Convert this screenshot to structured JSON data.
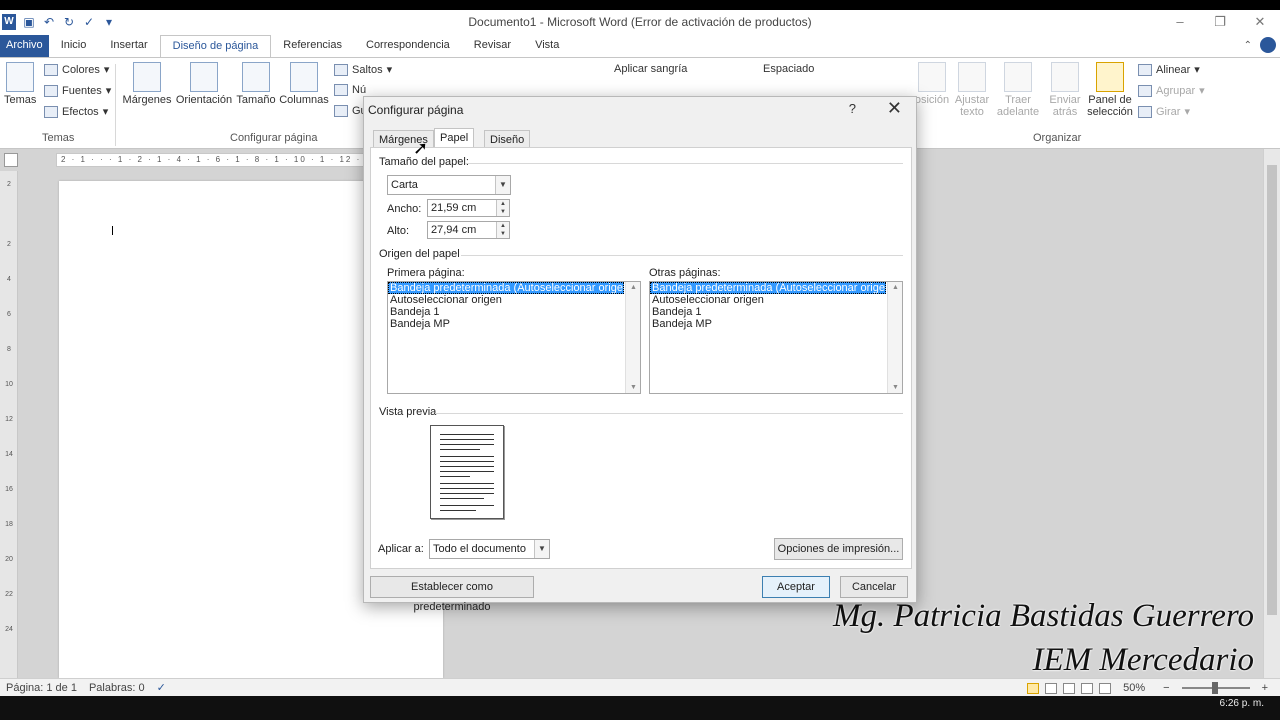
{
  "window": {
    "title": "Documento1 - Microsoft Word (Error de activación de productos)",
    "buttons": [
      "–",
      "❐",
      "✕"
    ]
  },
  "qat": {
    "logo": "W",
    "save_icon": "save-icon",
    "undo_icon": "undo-icon",
    "redo_icon": "redo-icon",
    "spell_icon": "spellcheck-icon"
  },
  "tabs": [
    "Archivo",
    "Inicio",
    "Insertar",
    "Diseño de página",
    "Referencias",
    "Correspondencia",
    "Revisar",
    "Vista"
  ],
  "active_tab": "Diseño de página",
  "ribbon": {
    "temas": {
      "label": "Temas",
      "group": "Temas"
    },
    "colores": "Colores",
    "fuentes": "Fuentes",
    "efectos": "Efectos",
    "margenes": "Márgenes",
    "orientacion": "Orientación",
    "tamano": "Tamaño",
    "columnas": "Columnas",
    "saltos": "Saltos",
    "numeros": "Nú",
    "guiones": "Gu",
    "configurar_group": "Configurar página",
    "aplicar_sangria": "Aplicar sangría",
    "espaciado": "Espaciado",
    "posicion": "osición",
    "ajustar_texto_1": "Ajustar",
    "ajustar_texto_2": "texto",
    "traer_1": "Traer",
    "traer_2": "adelante",
    "enviar_1": "Enviar",
    "enviar_2": "atrás",
    "panel_1": "Panel de",
    "panel_2": "selección",
    "alinear": "Alinear",
    "agrupar": "Agrupar",
    "girar": "Girar",
    "organizar_group": "Organizar"
  },
  "ruler": {
    "h_text": "2 · 1 · · · 1 · 2 · 1 · 4 · 1 · 6 · 1 · 8 · 1 · 10 · 1 · 12 · 1 · 14",
    "v_ticks": [
      "2",
      "2",
      "4",
      "6",
      "8",
      "10",
      "12",
      "14",
      "16",
      "18",
      "20",
      "22",
      "24"
    ]
  },
  "dialog": {
    "title": "Configurar página",
    "help": "?",
    "close": "✕",
    "tabs": [
      "Márgenes",
      "Papel",
      "Diseño"
    ],
    "active_tab": "Papel",
    "paper_size_label": "Tamaño del papel:",
    "paper_size_value": "Carta",
    "width_label": "Ancho:",
    "width_value": "21,59 cm",
    "height_label": "Alto:",
    "height_value": "27,94 cm",
    "origin_label": "Origen del papel",
    "first_page_label": "Primera página:",
    "other_pages_label": "Otras páginas:",
    "first_page_items": [
      "Bandeja predeterminada (Autoseleccionar origen)",
      "Autoseleccionar origen",
      "Bandeja 1",
      "Bandeja MP"
    ],
    "other_pages_items": [
      "Bandeja predeterminada (Autoseleccionar origen)",
      "Autoseleccionar origen",
      "Bandeja 1",
      "Bandeja MP"
    ],
    "preview_label": "Vista previa",
    "apply_label": "Aplicar a:",
    "apply_value": "Todo el documento",
    "print_options": "Opciones de impresión...",
    "set_default": "Establecer como predeterminado",
    "ok": "Aceptar",
    "cancel": "Cancelar"
  },
  "watermark": {
    "line1": "Mg. Patricia Bastidas Guerrero",
    "line2": "IEM Mercedario"
  },
  "status": {
    "page": "Página: 1 de 1",
    "words": "Palabras: 0",
    "zoom": "50%",
    "minus": "−",
    "plus": "+"
  },
  "taskbar": {
    "clock": "6:26 p. m."
  },
  "colors": {
    "accent": "#2b579a",
    "selection": "#3399ff"
  }
}
